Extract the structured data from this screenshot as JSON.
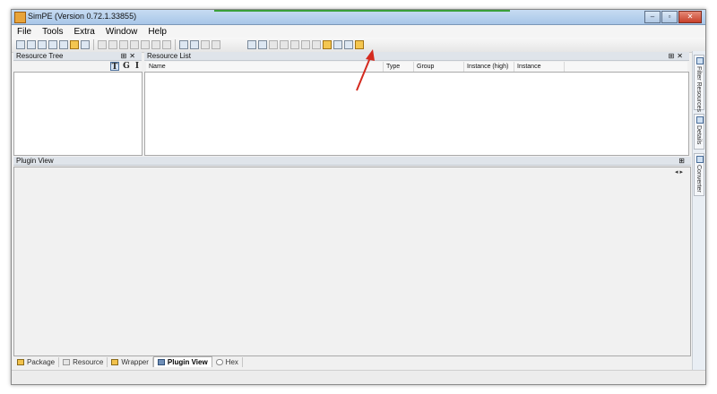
{
  "window": {
    "title": "SimPE (Version 0.72.1.33855)"
  },
  "window_controls": {
    "minimize": "‒",
    "maximize": "▫",
    "close": "✕"
  },
  "menu": [
    "File",
    "Tools",
    "Extra",
    "Window",
    "Help"
  ],
  "resource_tree": {
    "header": "Resource Tree",
    "pin": "⊞",
    "close": "✕",
    "mode_buttons": [
      "T",
      "G",
      "I"
    ]
  },
  "resource_list": {
    "header": "Resource List",
    "pin": "⊞",
    "close": "✕",
    "columns": [
      "Name",
      "Type",
      "Group",
      "Instance (high)",
      "Instance"
    ]
  },
  "plugin_view": {
    "header": "Plugin View",
    "pin": "⊞",
    "nav": "◂ ▸"
  },
  "right_tabs": [
    "Filter Resources",
    "Details",
    "Converter"
  ],
  "bottom_tabs": [
    {
      "label": "Package",
      "active": false
    },
    {
      "label": "Resource",
      "active": false
    },
    {
      "label": "Wrapper",
      "active": false
    },
    {
      "label": "Plugin View",
      "active": true
    },
    {
      "label": "Hex",
      "active": false
    }
  ],
  "colors": {
    "annotation_arrow": "#d42a1f",
    "titlebar": "#b7d0ec"
  }
}
